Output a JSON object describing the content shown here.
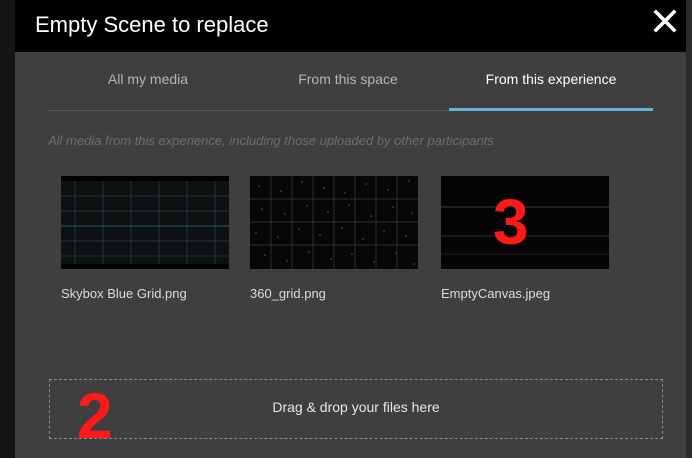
{
  "modal": {
    "title": "Empty Scene to replace",
    "close_icon": "close-icon"
  },
  "tabs": [
    {
      "label": "All my media",
      "active": false
    },
    {
      "label": "From this space",
      "active": false
    },
    {
      "label": "From this experience",
      "active": true
    }
  ],
  "hint": "All media from this experience, including those uploaded by other participants",
  "media": [
    {
      "name": "Skybox Blue Grid.png",
      "thumbnail": "blue-grid-thumbnail"
    },
    {
      "name": "360_grid.png",
      "thumbnail": "star-grid-thumbnail"
    },
    {
      "name": "EmptyCanvas.jpeg",
      "thumbnail": "dark-canvas-thumbnail"
    }
  ],
  "dropzone": {
    "label": "Drag & drop your files here"
  },
  "annotations": {
    "marker_2": "2",
    "marker_3": "3"
  },
  "colors": {
    "header_bg": "#000000",
    "modal_bg": "#3f3f3f",
    "active_tab_underline": "#63b3d8",
    "annotation": "#ff1a1a"
  }
}
